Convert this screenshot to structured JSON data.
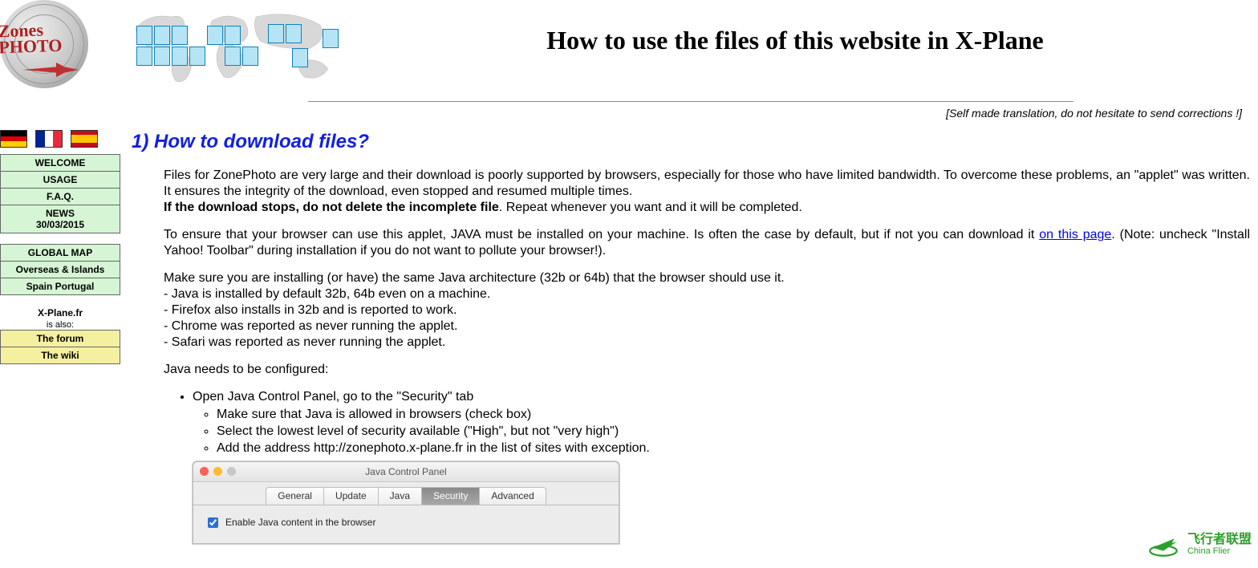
{
  "logo": {
    "line1": "Zones",
    "line2": "PHOTO"
  },
  "flags": {
    "de": "German",
    "fr": "French",
    "es": "Spanish"
  },
  "nav": {
    "main": [
      "WELCOME",
      "USAGE",
      "F.A.Q."
    ],
    "news_label": "NEWS",
    "news_date": "30/03/2015",
    "maps": [
      "GLOBAL MAP",
      "Overseas & Islands",
      "Spain Portugal"
    ],
    "also_title": "X-Plane.fr",
    "also_sub": "is also:",
    "also_links": [
      "The forum",
      "The wiki"
    ]
  },
  "title": "How to use the files of this website in X-Plane",
  "translation_note": "[Self made translation, do not hesitate to send corrections !]",
  "section1": {
    "heading": "1) How to download files?",
    "p1": "Files for ZonePhoto are very large and their download is poorly supported by browsers, especially for those who have limited bandwidth. To overcome these problems, an \"applet\" was written. It ensures the integrity of the download, even stopped and resumed multiple times.",
    "p1b_strong": "If the download stops, do not delete the incomplete file",
    "p1b_rest": ". Repeat whenever you want and it will be completed.",
    "p2_pre": "To ensure that your browser can use this applet, JAVA must be installed on your machine. Is often the case by default, but if not you can download it ",
    "p2_link": "on this page",
    "p2_post": ". (Note: uncheck \"Install Yahoo! Toolbar\" during installation if you do not want to pollute your browser!).",
    "p3_lines": [
      "Make sure you are installing (or have) the same Java architecture (32b or 64b) that the browser should use it.",
      "- Java is installed by default 32b, 64b even on a machine.",
      "- Firefox also installs in 32b and is reported to work.",
      "- Chrome was reported as never running the applet.",
      "- Safari was reported as never running the applet."
    ],
    "p4": "Java needs to be configured:",
    "bullets": {
      "b1": "Open Java Control Panel, go to the \"Security\" tab",
      "sub": [
        "Make sure that Java is allowed in browsers (check box)",
        "Select the lowest level of security available (\"High\", but not \"very high\")",
        "Add the address http://zonephoto.x-plane.fr in the list of sites with exception."
      ]
    }
  },
  "jcp": {
    "title": "Java Control Panel",
    "tabs": [
      "General",
      "Update",
      "Java",
      "Security",
      "Advanced"
    ],
    "active_tab": "Security",
    "checkbox_label": "Enable Java content in the browser"
  },
  "watermark": {
    "zh": "飞行者联盟",
    "en": "China Flier"
  }
}
